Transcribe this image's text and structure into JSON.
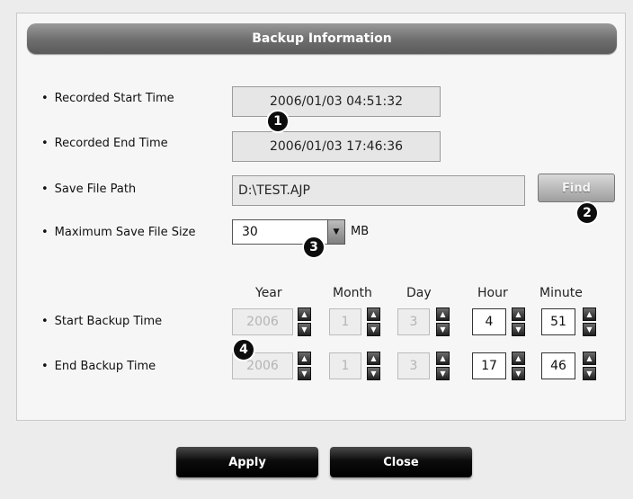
{
  "dialog": {
    "title": "Backup Information"
  },
  "fields": {
    "recorded_start_label": "Recorded Start Time",
    "recorded_start_value": "2006/01/03 04:51:32",
    "recorded_end_label": "Recorded End Time",
    "recorded_end_value": "2006/01/03 17:46:36",
    "save_path_label": "Save File Path",
    "save_path_value": "D:\\TEST.AJP",
    "find_label": "Find",
    "max_size_label": "Maximum Save File Size",
    "max_size_value": "30",
    "max_size_unit": "MB"
  },
  "backup_time": {
    "columns": [
      "Year",
      "Month",
      "Day",
      "Hour",
      "Minute"
    ],
    "start_label": "Start Backup Time",
    "start": [
      "2006",
      "1",
      "3",
      "4",
      "51"
    ],
    "end_label": "End Backup Time",
    "end": [
      "2006",
      "1",
      "3",
      "17",
      "46"
    ]
  },
  "callouts": [
    "1",
    "2",
    "3",
    "4"
  ],
  "buttons": {
    "apply": "Apply",
    "close": "Close"
  },
  "icons": {
    "spin_up": "triangle-up-icon",
    "spin_down": "triangle-down-icon",
    "dropdown": "chevron-down-icon"
  }
}
